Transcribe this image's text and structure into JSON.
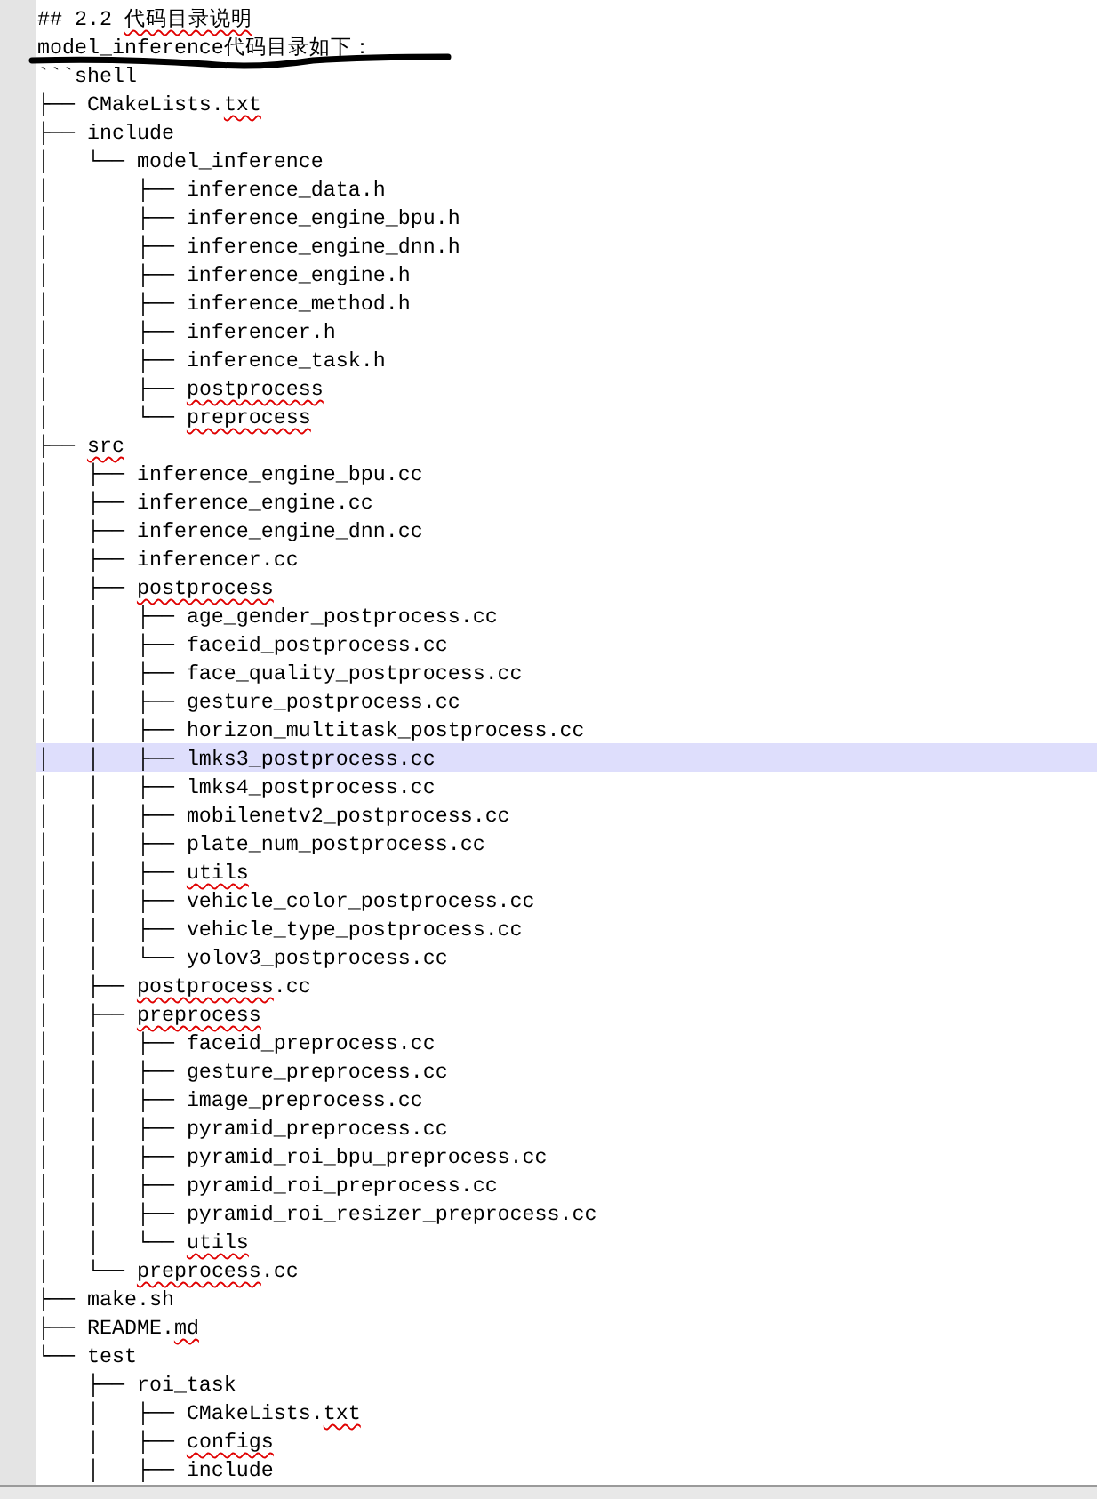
{
  "lines": [
    {
      "selected": false,
      "segments": [
        {
          "text": "## 2.2 ",
          "misspelled": false
        },
        {
          "text": "代码目录说明",
          "misspelled": true
        }
      ]
    },
    {
      "selected": false,
      "segments": [
        {
          "text": "model_inference代码目录如下：",
          "misspelled": false
        }
      ]
    },
    {
      "selected": false,
      "segments": [
        {
          "text": "```shell",
          "misspelled": false
        }
      ]
    },
    {
      "selected": false,
      "segments": [
        {
          "text": "├── CMakeLists.",
          "misspelled": false
        },
        {
          "text": "txt",
          "misspelled": true
        }
      ]
    },
    {
      "selected": false,
      "segments": [
        {
          "text": "├── include",
          "misspelled": false
        }
      ]
    },
    {
      "selected": false,
      "segments": [
        {
          "text": "│   └── model_inference",
          "misspelled": false
        }
      ]
    },
    {
      "selected": false,
      "segments": [
        {
          "text": "│       ├── inference_data.h",
          "misspelled": false
        }
      ]
    },
    {
      "selected": false,
      "segments": [
        {
          "text": "│       ├── inference_engine_bpu.h",
          "misspelled": false
        }
      ]
    },
    {
      "selected": false,
      "segments": [
        {
          "text": "│       ├── inference_engine_dnn.h",
          "misspelled": false
        }
      ]
    },
    {
      "selected": false,
      "segments": [
        {
          "text": "│       ├── inference_engine.h",
          "misspelled": false
        }
      ]
    },
    {
      "selected": false,
      "segments": [
        {
          "text": "│       ├── inference_method.h",
          "misspelled": false
        }
      ]
    },
    {
      "selected": false,
      "segments": [
        {
          "text": "│       ├── inferencer.h",
          "misspelled": false
        }
      ]
    },
    {
      "selected": false,
      "segments": [
        {
          "text": "│       ├── inference_task.h",
          "misspelled": false
        }
      ]
    },
    {
      "selected": false,
      "segments": [
        {
          "text": "│       ├── ",
          "misspelled": false
        },
        {
          "text": "postprocess",
          "misspelled": true
        }
      ]
    },
    {
      "selected": false,
      "segments": [
        {
          "text": "│       └── ",
          "misspelled": false
        },
        {
          "text": "preprocess",
          "misspelled": true
        }
      ]
    },
    {
      "selected": false,
      "segments": [
        {
          "text": "├── ",
          "misspelled": false
        },
        {
          "text": "src",
          "misspelled": true
        }
      ]
    },
    {
      "selected": false,
      "segments": [
        {
          "text": "│   ├── inference_engine_bpu.cc",
          "misspelled": false
        }
      ]
    },
    {
      "selected": false,
      "segments": [
        {
          "text": "│   ├── inference_engine.cc",
          "misspelled": false
        }
      ]
    },
    {
      "selected": false,
      "segments": [
        {
          "text": "│   ├── inference_engine_dnn.cc",
          "misspelled": false
        }
      ]
    },
    {
      "selected": false,
      "segments": [
        {
          "text": "│   ├── inferencer.cc",
          "misspelled": false
        }
      ]
    },
    {
      "selected": false,
      "segments": [
        {
          "text": "│   ├── ",
          "misspelled": false
        },
        {
          "text": "postprocess",
          "misspelled": true
        }
      ]
    },
    {
      "selected": false,
      "segments": [
        {
          "text": "│   │   ├── age_gender_postprocess.cc",
          "misspelled": false
        }
      ]
    },
    {
      "selected": false,
      "segments": [
        {
          "text": "│   │   ├── faceid_postprocess.cc",
          "misspelled": false
        }
      ]
    },
    {
      "selected": false,
      "segments": [
        {
          "text": "│   │   ├── face_quality_postprocess.cc",
          "misspelled": false
        }
      ]
    },
    {
      "selected": false,
      "segments": [
        {
          "text": "│   │   ├── gesture_postprocess.cc",
          "misspelled": false
        }
      ]
    },
    {
      "selected": false,
      "segments": [
        {
          "text": "│   │   ├── horizon_multitask_postprocess.cc",
          "misspelled": false
        }
      ]
    },
    {
      "selected": true,
      "segments": [
        {
          "text": "│   │   ├── lmks3_postprocess.cc",
          "misspelled": false
        }
      ]
    },
    {
      "selected": false,
      "segments": [
        {
          "text": "│   │   ├── lmks4_postprocess.cc",
          "misspelled": false
        }
      ]
    },
    {
      "selected": false,
      "segments": [
        {
          "text": "│   │   ├── mobilenetv2_postprocess.cc",
          "misspelled": false
        }
      ]
    },
    {
      "selected": false,
      "segments": [
        {
          "text": "│   │   ├── plate_num_postprocess.cc",
          "misspelled": false
        }
      ]
    },
    {
      "selected": false,
      "segments": [
        {
          "text": "│   │   ├── ",
          "misspelled": false
        },
        {
          "text": "utils",
          "misspelled": true
        }
      ]
    },
    {
      "selected": false,
      "segments": [
        {
          "text": "│   │   ├── vehicle_color_postprocess.cc",
          "misspelled": false
        }
      ]
    },
    {
      "selected": false,
      "segments": [
        {
          "text": "│   │   ├── vehicle_type_postprocess.cc",
          "misspelled": false
        }
      ]
    },
    {
      "selected": false,
      "segments": [
        {
          "text": "│   │   └── yolov3_postprocess.cc",
          "misspelled": false
        }
      ]
    },
    {
      "selected": false,
      "segments": [
        {
          "text": "│   ├── ",
          "misspelled": false
        },
        {
          "text": "postprocess",
          "misspelled": true
        },
        {
          "text": ".cc",
          "misspelled": false
        }
      ]
    },
    {
      "selected": false,
      "segments": [
        {
          "text": "│   ├── ",
          "misspelled": false
        },
        {
          "text": "preprocess",
          "misspelled": true
        }
      ]
    },
    {
      "selected": false,
      "segments": [
        {
          "text": "│   │   ├── faceid_preprocess.cc",
          "misspelled": false
        }
      ]
    },
    {
      "selected": false,
      "segments": [
        {
          "text": "│   │   ├── gesture_preprocess.cc",
          "misspelled": false
        }
      ]
    },
    {
      "selected": false,
      "segments": [
        {
          "text": "│   │   ├── image_preprocess.cc",
          "misspelled": false
        }
      ]
    },
    {
      "selected": false,
      "segments": [
        {
          "text": "│   │   ├── pyramid_preprocess.cc",
          "misspelled": false
        }
      ]
    },
    {
      "selected": false,
      "segments": [
        {
          "text": "│   │   ├── pyramid_roi_bpu_preprocess.cc",
          "misspelled": false
        }
      ]
    },
    {
      "selected": false,
      "segments": [
        {
          "text": "│   │   ├── pyramid_roi_preprocess.cc",
          "misspelled": false
        }
      ]
    },
    {
      "selected": false,
      "segments": [
        {
          "text": "│   │   ├── pyramid_roi_resizer_preprocess.cc",
          "misspelled": false
        }
      ]
    },
    {
      "selected": false,
      "segments": [
        {
          "text": "│   │   └── ",
          "misspelled": false
        },
        {
          "text": "utils",
          "misspelled": true
        }
      ]
    },
    {
      "selected": false,
      "segments": [
        {
          "text": "│   └── ",
          "misspelled": false
        },
        {
          "text": "preprocess",
          "misspelled": true
        },
        {
          "text": ".cc",
          "misspelled": false
        }
      ]
    },
    {
      "selected": false,
      "segments": [
        {
          "text": "├── make.sh",
          "misspelled": false
        }
      ]
    },
    {
      "selected": false,
      "segments": [
        {
          "text": "├── README.",
          "misspelled": false
        },
        {
          "text": "md",
          "misspelled": true
        }
      ]
    },
    {
      "selected": false,
      "segments": [
        {
          "text": "└── test",
          "misspelled": false
        }
      ]
    },
    {
      "selected": false,
      "segments": [
        {
          "text": "    ├── roi_task",
          "misspelled": false
        }
      ]
    },
    {
      "selected": false,
      "segments": [
        {
          "text": "    │   ├── CMakeLists.",
          "misspelled": false
        },
        {
          "text": "txt",
          "misspelled": true
        }
      ]
    },
    {
      "selected": false,
      "segments": [
        {
          "text": "    │   ├── ",
          "misspelled": false
        },
        {
          "text": "configs",
          "misspelled": true
        }
      ]
    },
    {
      "selected": false,
      "segments": [
        {
          "text": "    │   ├── include",
          "misspelled": false
        }
      ]
    }
  ]
}
